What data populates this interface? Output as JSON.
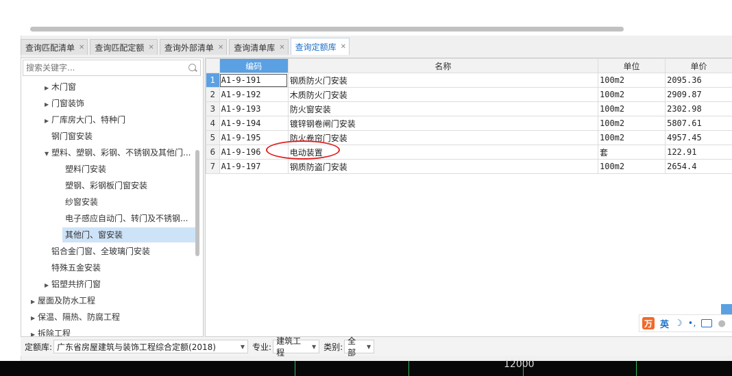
{
  "tabs": [
    {
      "label": "查询匹配清单",
      "active": false
    },
    {
      "label": "查询匹配定额",
      "active": false
    },
    {
      "label": "查询外部清单",
      "active": false
    },
    {
      "label": "查询清单库",
      "active": false
    },
    {
      "label": "查询定额库",
      "active": true
    }
  ],
  "search": {
    "placeholder": "搜索关键字..."
  },
  "tree": [
    {
      "label": "木门窗",
      "arrow": "right"
    },
    {
      "label": "门窗装饰",
      "arrow": "right"
    },
    {
      "label": "厂库房大门、特种门",
      "arrow": "right"
    },
    {
      "label": "钢门窗安装",
      "arrow": ""
    },
    {
      "label": "塑料、塑钢、彩钢、不锈钢及其他门...",
      "arrow": "down"
    },
    {
      "label": "塑料门安装",
      "arrow": ""
    },
    {
      "label": "塑钢、彩钢板门窗安装",
      "arrow": ""
    },
    {
      "label": "纱窗安装",
      "arrow": ""
    },
    {
      "label": "电子感应自动门、转门及不锈钢...",
      "arrow": ""
    },
    {
      "label": "其他门、窗安装",
      "arrow": "",
      "selected": true
    },
    {
      "label": "铝合金门窗、全玻璃门安装",
      "arrow": ""
    },
    {
      "label": "特殊五金安装",
      "arrow": ""
    },
    {
      "label": "铝塑共挤门窗",
      "arrow": "right"
    },
    {
      "label": "屋面及防水工程",
      "arrow": "right"
    },
    {
      "label": "保温、隔热、防腐工程",
      "arrow": "right"
    },
    {
      "label": "拆除工程",
      "arrow": "right"
    }
  ],
  "grid": {
    "columns": [
      "编码",
      "名称",
      "单位",
      "单价"
    ],
    "rows": [
      {
        "num": "1",
        "code": "A1-9-191",
        "name": "钢质防火门安装",
        "unit": "100m2",
        "price": "2095.36"
      },
      {
        "num": "2",
        "code": "A1-9-192",
        "name": "木质防火门安装",
        "unit": "100m2",
        "price": "2909.87"
      },
      {
        "num": "3",
        "code": "A1-9-193",
        "name": "防火窗安装",
        "unit": "100m2",
        "price": "2302.98"
      },
      {
        "num": "4",
        "code": "A1-9-194",
        "name": "镀锌钢卷闸门安装",
        "unit": "100m2",
        "price": "5807.61"
      },
      {
        "num": "5",
        "code": "A1-9-195",
        "name": "防火卷帘门安装",
        "unit": "100m2",
        "price": "4957.45"
      },
      {
        "num": "6",
        "code": "A1-9-196",
        "name": "电动装置",
        "unit": "套",
        "price": "122.91"
      },
      {
        "num": "7",
        "code": "A1-9-197",
        "name": "钢质防盗门安装",
        "unit": "100m2",
        "price": "2654.4"
      }
    ]
  },
  "bottom": {
    "quota_label": "定额库:",
    "quota_value": "广东省房屋建筑与装饰工程综合定额(2018)",
    "major_label": "专业:",
    "major_value": "建筑工程",
    "category_label": "类别:",
    "category_value": "全部"
  },
  "footer": {
    "scale_text": "12000"
  },
  "ime": {
    "logo": "万",
    "lang": "英"
  },
  "colors": {
    "accent": "#5aa0e3",
    "highlight": "#e02020",
    "selected_row": "#cde3f7"
  }
}
